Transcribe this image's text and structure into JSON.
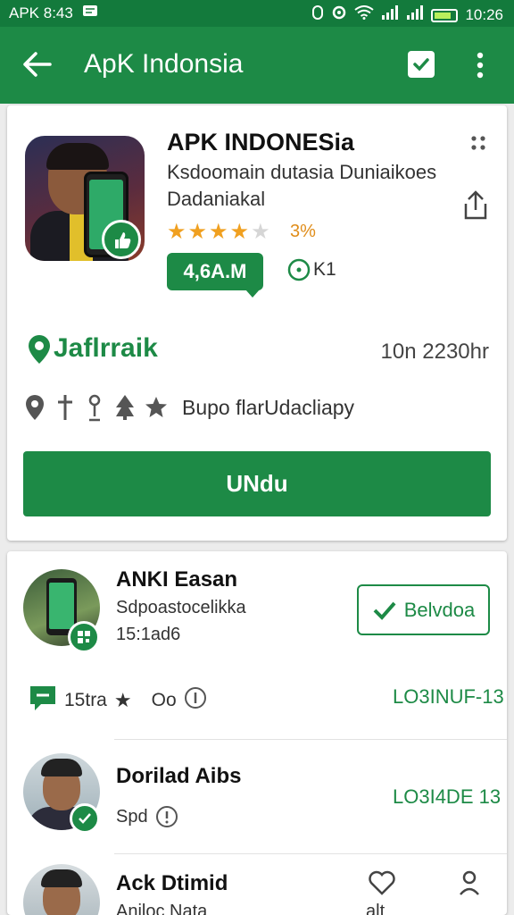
{
  "status_bar": {
    "left_text": "APK 8:43",
    "time": "10:26"
  },
  "app_bar": {
    "title": "ApK Indonsia"
  },
  "app_card": {
    "name": "APK INDONESia",
    "subtitle_1": "Ksdoomain dutasia Duniaikoes",
    "subtitle_2": "Dadaniakal",
    "rating": 4,
    "rating_max": 5,
    "rating_value": "3%",
    "size_label": "4,6A.M",
    "clock_text": "K1",
    "brand_name": "Jaflrraik",
    "date": "10n 2230hr",
    "meta_text": "Bupo flarUdacliapy",
    "download_label": "UNdu",
    "colors": {
      "accent": "#1d8a46",
      "star": "#f0a020",
      "star_empty": "#d6d6d6"
    }
  },
  "list": {
    "items": [
      {
        "title": "ANKI Easan",
        "subtitle": "Sdpoastocelikka",
        "meta": "15:1ad6",
        "button_label": "Belvdoa",
        "stat_count": "15tra",
        "stat_extra": "Oo",
        "right_code": "LO3INUF-13"
      },
      {
        "title": "Dorilad Aibs",
        "subtitle": "Spd",
        "right_code": "LO3I4DE 13"
      },
      {
        "title": "Ack Dtimid",
        "subtitle": "Aniloc Nata",
        "right_code": "alt"
      }
    ]
  },
  "icons": {
    "back": "arrow-left-icon",
    "check": "check-box-icon",
    "more": "more-vert-icon",
    "share": "share-icon",
    "grid": "grid-dots-icon",
    "location": "location-pin-icon",
    "cross": "cross-icon",
    "person": "person-icon",
    "tree": "tree-icon",
    "star": "star-icon",
    "chat": "chat-icon",
    "info": "info-icon",
    "heart": "heart-icon",
    "profile": "profile-icon"
  }
}
